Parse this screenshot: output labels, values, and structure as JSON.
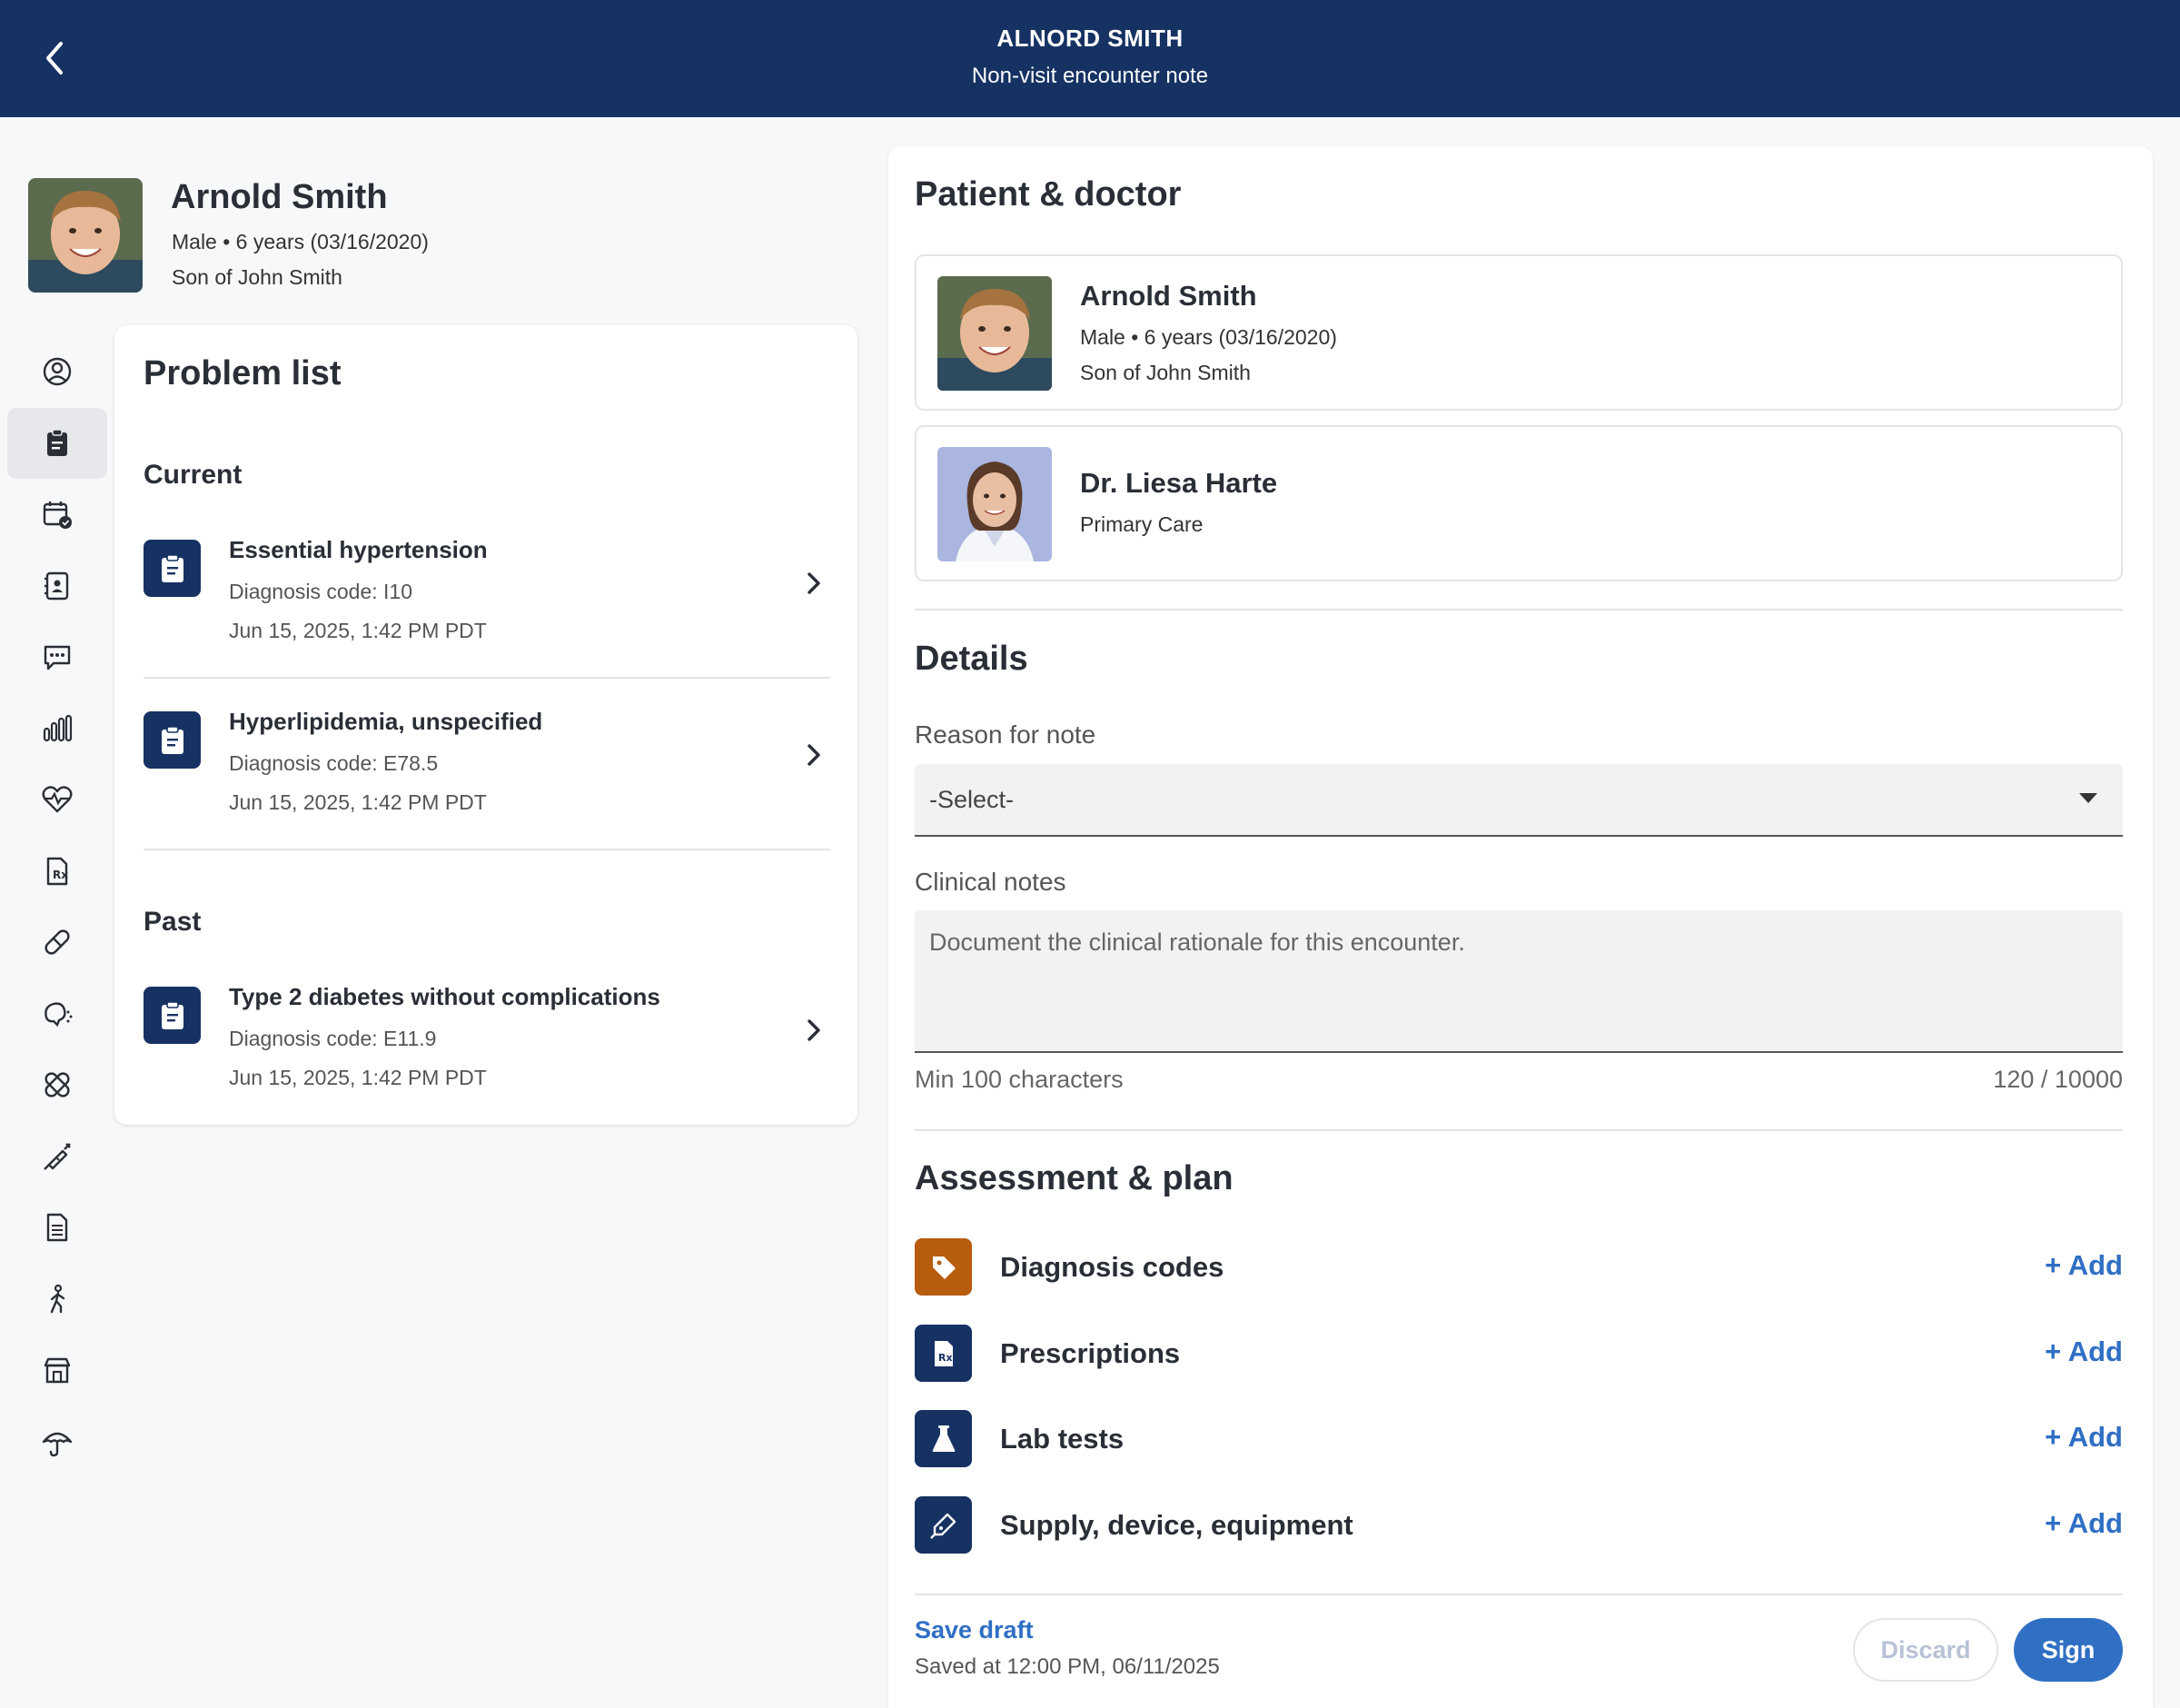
{
  "header": {
    "title": "ALNORD SMITH",
    "subtitle": "Non-visit encounter note"
  },
  "patient": {
    "name": "Arnold Smith",
    "meta": "Male • 6 years (03/16/2020)",
    "relation": "Son of John Smith"
  },
  "nav": {
    "items": [
      "profile-icon",
      "clipboard-icon",
      "calendar-check-icon",
      "contacts-book-icon",
      "chat-bubble-icon",
      "bar-chart-icon",
      "heart-pulse-icon",
      "prescription-icon",
      "pill-icon",
      "allergy-icon",
      "bandage-icon",
      "syringe-icon",
      "document-icon",
      "walking-person-icon",
      "store-icon",
      "umbrella-icon"
    ],
    "active_index": 1
  },
  "problem_list": {
    "title": "Problem list",
    "current_label": "Current",
    "past_label": "Past",
    "current": [
      {
        "name": "Essential hypertension",
        "code": "Diagnosis code: I10",
        "date": "Jun 15, 2025, 1:42 PM PDT"
      },
      {
        "name": "Hyperlipidemia, unspecified",
        "code": "Diagnosis code: E78.5",
        "date": "Jun 15, 2025, 1:42 PM PDT"
      }
    ],
    "past": [
      {
        "name": "Type 2 diabetes without complications",
        "code": "Diagnosis code: E11.9",
        "date": "Jun 15, 2025, 1:42 PM PDT"
      }
    ]
  },
  "patient_doctor": {
    "title": "Patient & doctor",
    "patient": {
      "name": "Arnold Smith",
      "meta": "Male • 6 years (03/16/2020)",
      "relation": "Son of John Smith"
    },
    "doctor": {
      "name": "Dr. Liesa Harte",
      "specialty": "Primary Care"
    }
  },
  "details": {
    "title": "Details",
    "reason_label": "Reason for note",
    "reason_value": "-Select-",
    "notes_label": "Clinical notes",
    "notes_placeholder": "Document the clinical rationale for this encounter.",
    "notes_hint": "Min 100 characters",
    "notes_count": "120 / 10000"
  },
  "assessment": {
    "title": "Assessment & plan",
    "items": [
      {
        "label": "Diagnosis codes",
        "icon": "tag-icon",
        "color": "#b85c0e",
        "action": "+ Add"
      },
      {
        "label": "Prescriptions",
        "icon": "prescription-icon",
        "color": "#163263",
        "action": "+ Add"
      },
      {
        "label": "Lab tests",
        "icon": "flask-icon",
        "color": "#163263",
        "action": "+ Add"
      },
      {
        "label": "Supply, device, equipment",
        "icon": "pen-tool-icon",
        "color": "#163263",
        "action": "+ Add"
      }
    ]
  },
  "footer": {
    "save_draft": "Save draft",
    "saved_at": "Saved at 12:00 PM, 06/11/2025",
    "discard": "Discard",
    "sign": "Sign"
  },
  "colors": {
    "brand": "#163263",
    "accent": "#2f6fc4",
    "diagnosis": "#b85c0e"
  }
}
